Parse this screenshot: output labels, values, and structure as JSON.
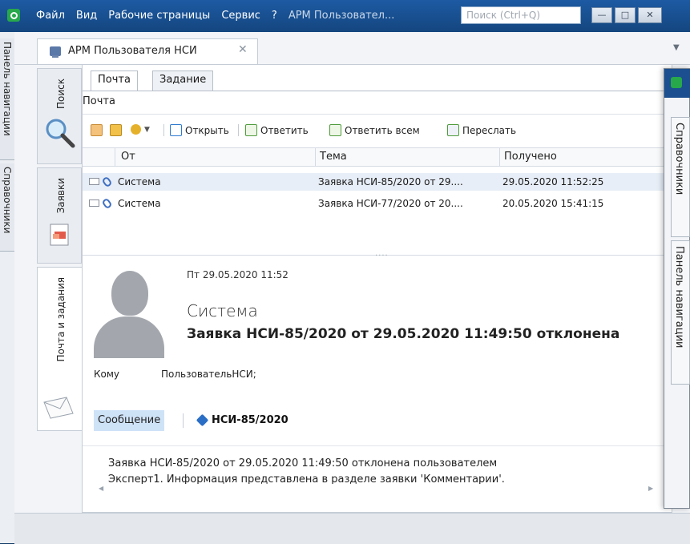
{
  "titlebar": {
    "menu": [
      "Файл",
      "Вид",
      "Рабочие страницы",
      "Сервис",
      "?"
    ],
    "window_title": "АРМ Пользовател...",
    "search_placeholder": "Поиск (Ctrl+Q)"
  },
  "left_strip": {
    "tabs": [
      "Панель навигации",
      "Справочники"
    ]
  },
  "doc_tab": {
    "label": "АРМ Пользователя НСИ"
  },
  "side_tabs": [
    {
      "label": "Поиск",
      "icon": "magnifier-icon"
    },
    {
      "label": "Заявки",
      "icon": "request-icon"
    },
    {
      "label": "Почта и задания",
      "icon": "envelope-icon"
    }
  ],
  "inner_tabs": [
    "Почта",
    "Задание"
  ],
  "inner_title": "Почта",
  "toolbar": {
    "open": "Открыть",
    "reply": "Ответить",
    "reply_all": "Ответить всем",
    "forward": "Переслать"
  },
  "grid": {
    "columns": [
      "От",
      "Тема",
      "Получено"
    ],
    "rows": [
      {
        "from": "Система",
        "subject": "Заявка НСИ-85/2020 от 29....",
        "received": "29.05.2020 11:52:25",
        "selected": true
      },
      {
        "from": "Система",
        "subject": "Заявка НСИ-77/2020 от 20....",
        "received": "20.05.2020 15:41:15",
        "selected": false
      }
    ]
  },
  "message": {
    "date": "Пт 29.05.2020 11:52",
    "from": "Система",
    "subject": "Заявка НСИ-85/2020 от 29.05.2020 11:49:50 отклонена",
    "to_label": "Кому",
    "to_value": "ПользовательНСИ;",
    "tab_message": "Сообщение",
    "attachment": "НСИ-85/2020",
    "body_line1": "Заявка НСИ-85/2020 от 29.05.2020 11:49:50 отклонена пользователем",
    "body_line2": "Эксперт1. Информация представлена в разделе заявки 'Комментарии'."
  },
  "float_window": {
    "tabs": [
      "Справочники",
      "Панель навигации"
    ]
  },
  "colors": {
    "titlebar": "#1d5aa3",
    "selection": "#e8eef7",
    "chip": "#cfe3f7",
    "brand_green": "#27a84a"
  }
}
